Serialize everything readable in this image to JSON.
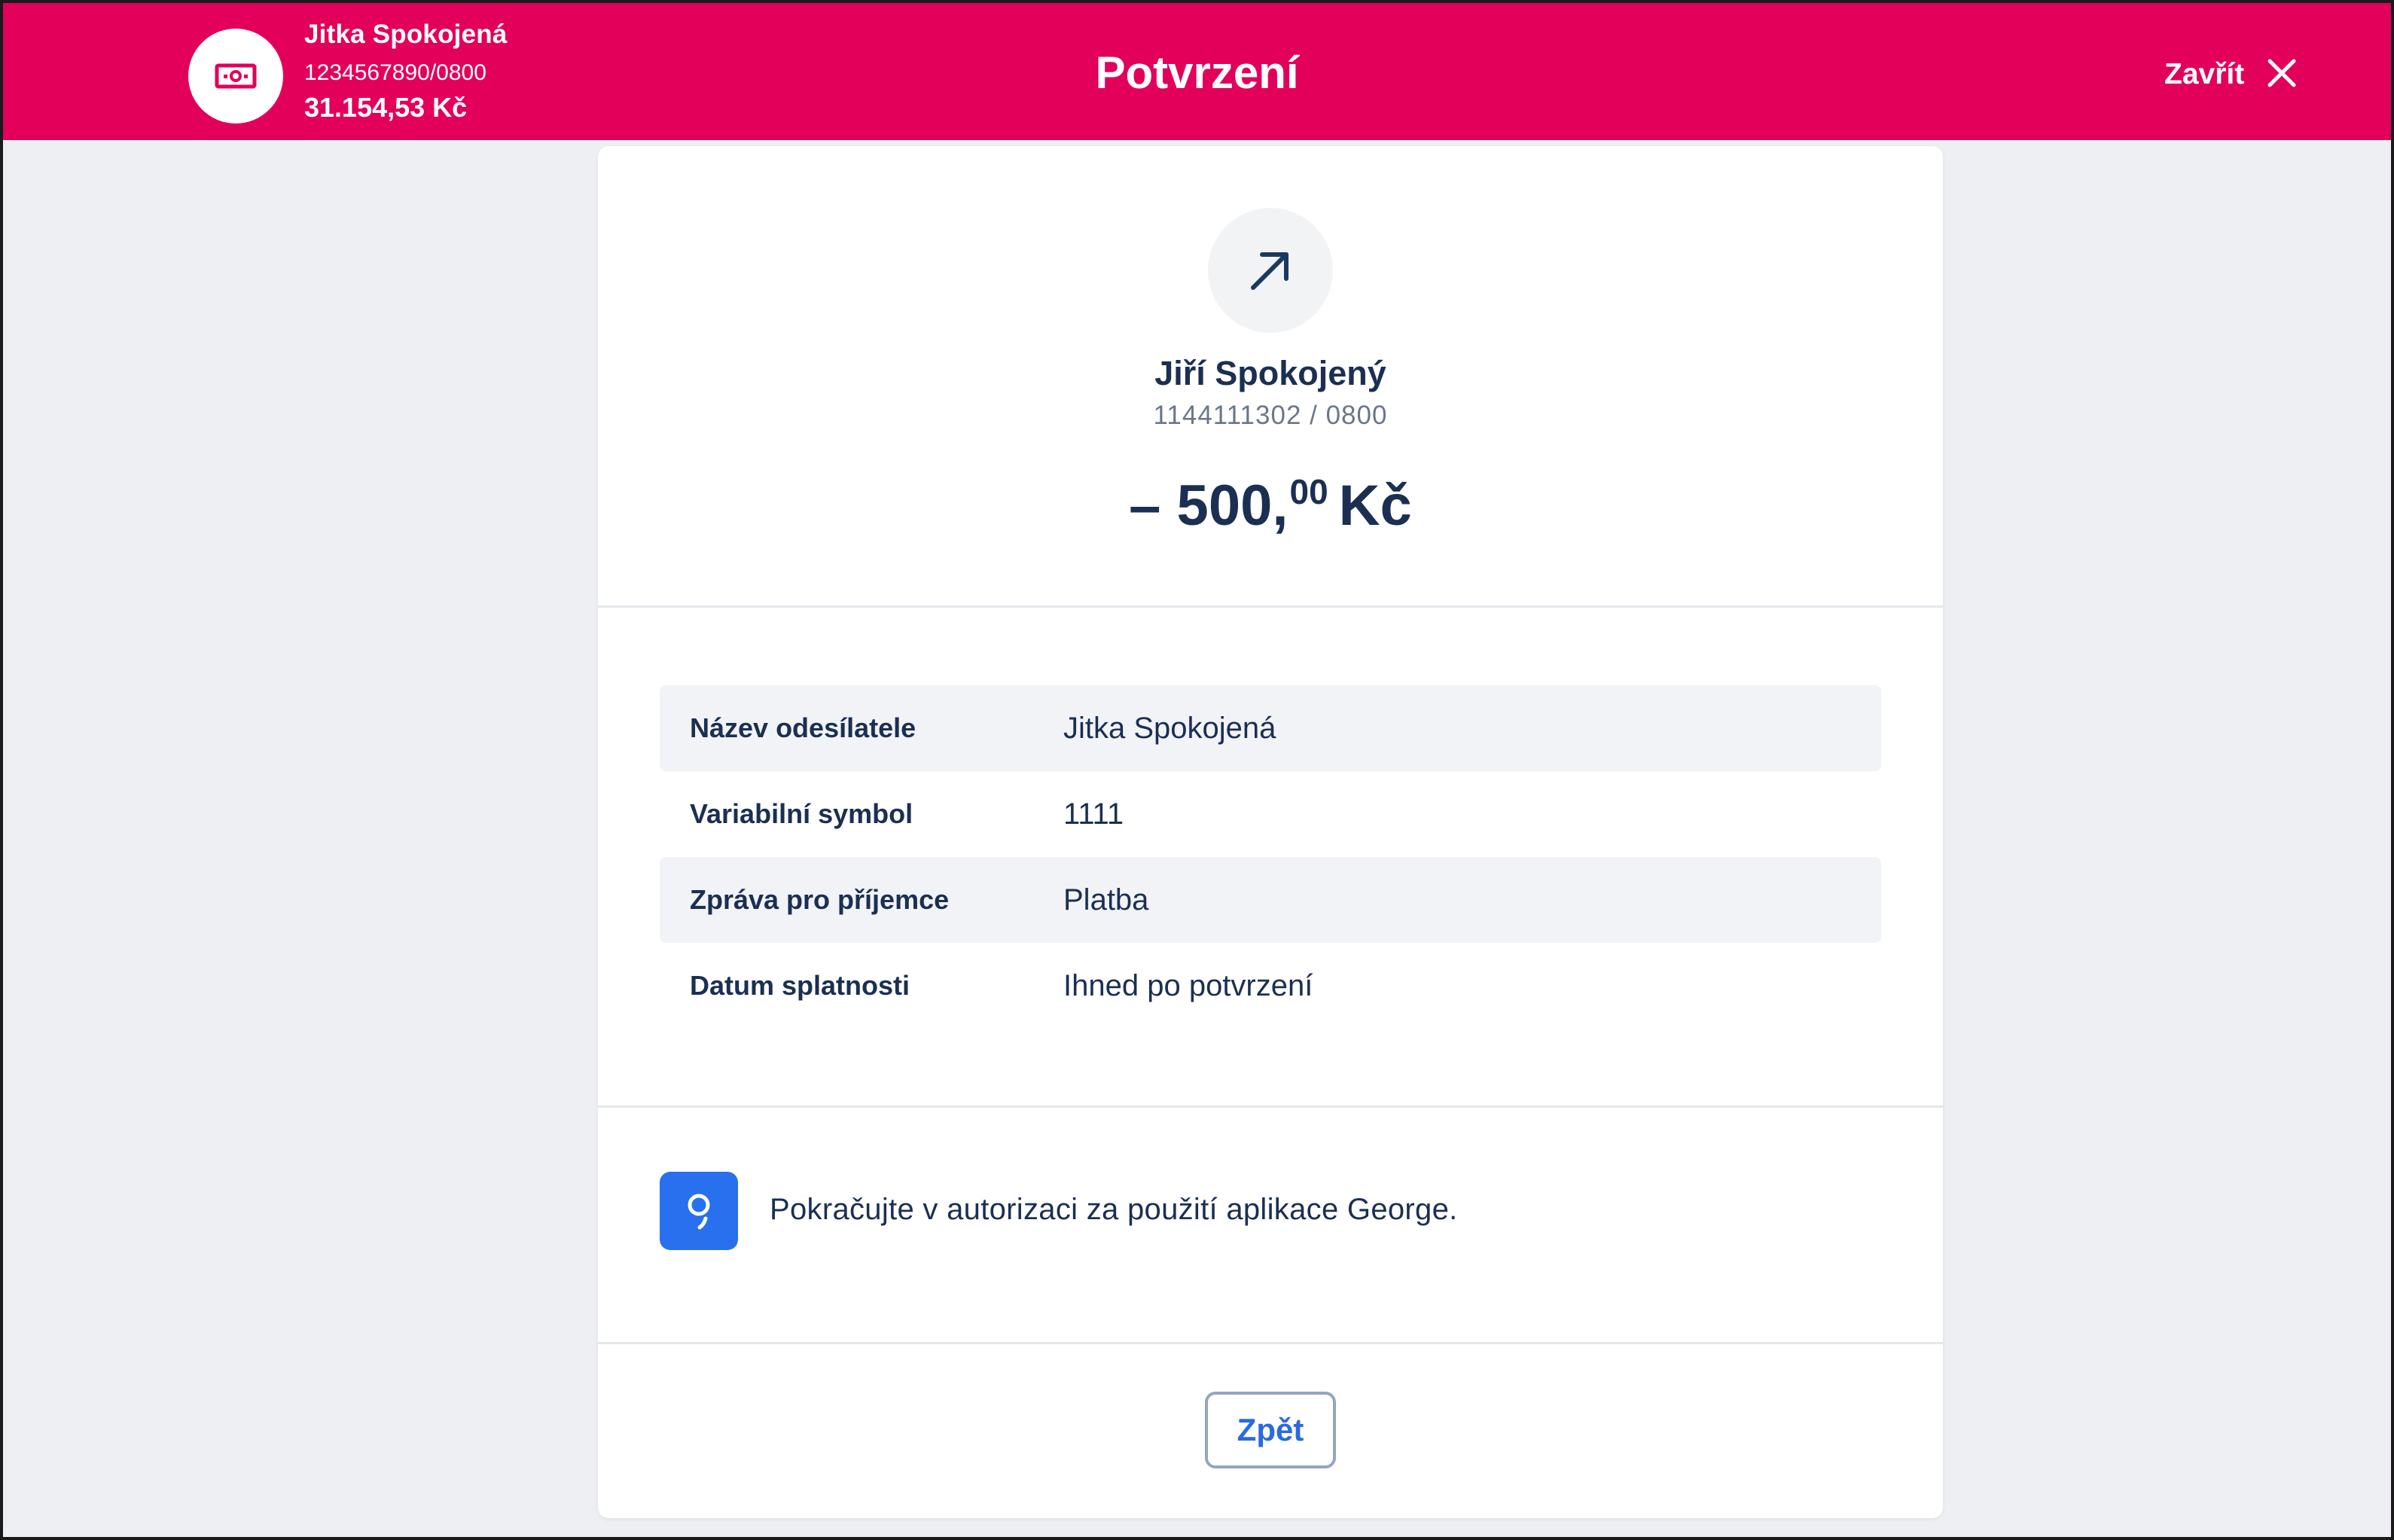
{
  "header": {
    "account_icon": "banknote-icon",
    "account_name": "Jitka Spokojená",
    "account_number": "1234567890/0800",
    "account_balance": "31.154,53 Kč",
    "title": "Potvrzení",
    "close_label": "Zavřít",
    "close_icon": "close-icon",
    "brand_color": "#e2005b"
  },
  "payment": {
    "direction_icon": "arrow-up-right-icon",
    "recipient_name": "Jiří Spokojený",
    "recipient_account": "1144111302 / 0800",
    "amount_main": "– 500,",
    "amount_decimals": "00",
    "amount_currency": "Kč"
  },
  "details": [
    {
      "label": "Název odesílatele",
      "value": "Jitka Spokojená"
    },
    {
      "label": "Variabilní symbol",
      "value": "1111"
    },
    {
      "label": "Zpráva pro příjemce",
      "value": "Platba"
    },
    {
      "label": "Datum splatnosti",
      "value": "Ihned po potvrzení"
    }
  ],
  "authorization": {
    "icon": "george-app-icon",
    "text": "Pokračujte v autorizaci za použití aplikace George.",
    "icon_color": "#2870ed"
  },
  "actions": {
    "back_label": "Zpět"
  }
}
